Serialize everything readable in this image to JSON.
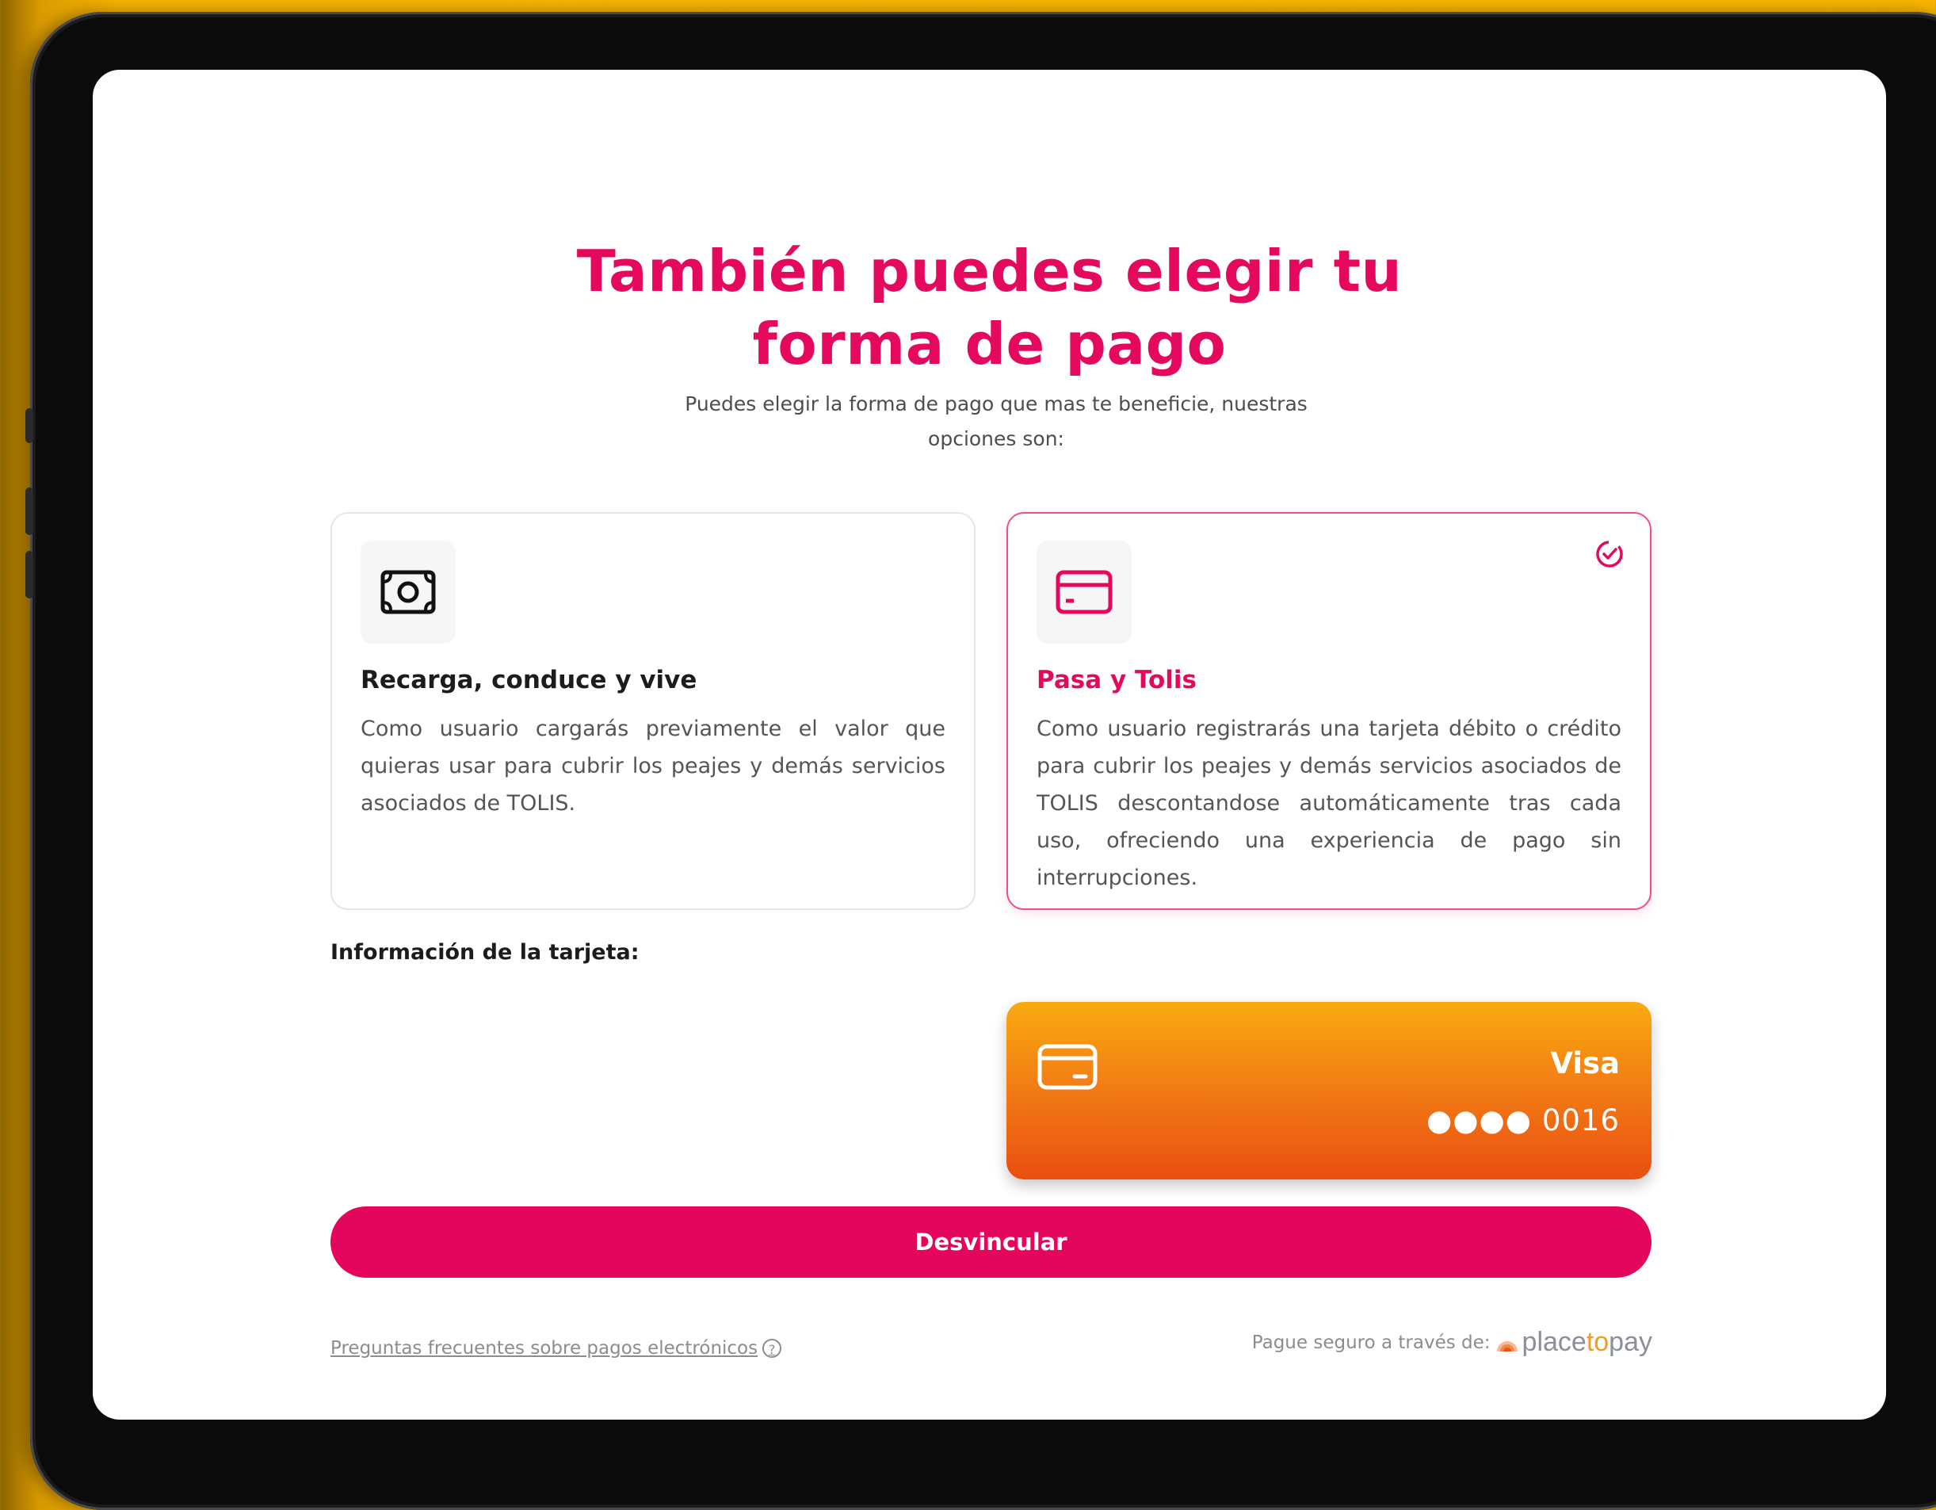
{
  "header": {
    "title_line1": "También puedes elegir tu",
    "title_line2": "forma de pago",
    "subtitle_line1": "Puedes elegir la forma de pago que mas te beneficie, nuestras",
    "subtitle_line2": "opciones son:"
  },
  "options": [
    {
      "icon": "cash-icon",
      "title": "Recarga, conduce y vive",
      "description": "Como usuario cargarás previamente el valor que quieras usar para cubrir los peajes y demás servicios asociados de TOLIS.",
      "selected": false
    },
    {
      "icon": "credit-card-icon",
      "title": "Pasa y Tolis",
      "description": "Como usuario registrarás una tarjeta débito o crédito para cubrir los peajes y demás servicios asociados de TOLIS descontandose automáticamente tras cada uso, ofreciendo una experiencia de pago sin interrupciones.",
      "selected": true
    }
  ],
  "card_info": {
    "label": "Información de la tarjeta:",
    "brand": "Visa",
    "masked_number": "●●●● 0016"
  },
  "actions": {
    "unlink_label": "Desvincular"
  },
  "footer": {
    "faq_link": "Preguntas frecuentes sobre pagos electrónicos",
    "secure_text": "Pague seguro a través de:",
    "logo_name": "placetopay"
  },
  "colors": {
    "accent": "#e5095d",
    "background": "#f8b500",
    "card_gradient_top": "#f9ab10",
    "card_gradient_bottom": "#e94f12"
  }
}
